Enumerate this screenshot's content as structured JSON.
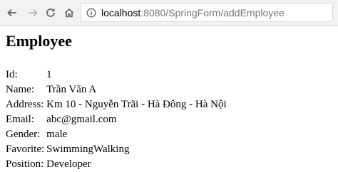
{
  "browser": {
    "url_host": "localhost",
    "url_path": ":8080/SpringForm/addEmployee",
    "icons": {
      "back": "arrow-left-icon",
      "forward": "arrow-right-icon",
      "reload": "reload-icon",
      "home": "home-icon",
      "info": "info-circle-icon"
    }
  },
  "page": {
    "heading": "Employee",
    "fields": [
      {
        "label": "Id:",
        "value": "1"
      },
      {
        "label": "Name:",
        "value": "Trần Văn A"
      },
      {
        "label": "Address:",
        "value": "Km 10 - Nguyễn Trãi - Hà Đông - Hà Nội"
      },
      {
        "label": "Email:",
        "value": "abc@gmail.com"
      },
      {
        "label": "Gender:",
        "value": "male"
      },
      {
        "label": "Favorite:",
        "value": "SwimmingWalking"
      },
      {
        "label": "Position:",
        "value": "Developer"
      }
    ]
  }
}
